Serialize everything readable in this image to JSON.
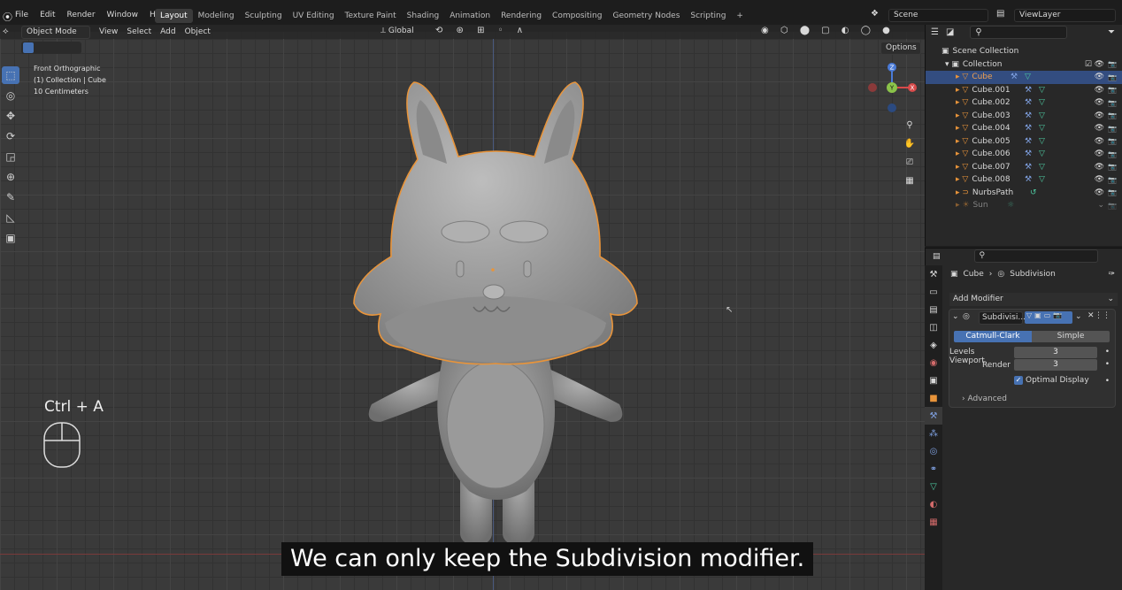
{
  "topbar": {
    "menus": [
      "File",
      "Edit",
      "Render",
      "Window",
      "Help"
    ],
    "workspaces": [
      "Layout",
      "Modeling",
      "Sculpting",
      "UV Editing",
      "Texture Paint",
      "Shading",
      "Animation",
      "Rendering",
      "Compositing",
      "Geometry Nodes",
      "Scripting"
    ],
    "add_ws": "+",
    "scene": "Scene",
    "view_layer": "ViewLayer"
  },
  "viewport": {
    "mode": "Object Mode",
    "menus": [
      "View",
      "Select",
      "Add",
      "Object"
    ],
    "orientation": "Global",
    "options": "Options",
    "overlay": [
      "Front Orthographic",
      "(1) Collection | Cube",
      "10 Centimeters"
    ],
    "gizmo": {
      "z": "Z",
      "y": "Y",
      "x": "X"
    },
    "shortcut": "Ctrl + A"
  },
  "outliner": {
    "scene_collection": "Scene Collection",
    "collection": "Collection",
    "items": [
      "Cube",
      "Cube.001",
      "Cube.002",
      "Cube.003",
      "Cube.004",
      "Cube.005",
      "Cube.006",
      "Cube.007",
      "Cube.008",
      "NurbsPath",
      "Sun"
    ]
  },
  "properties": {
    "breadcrumb_obj": "Cube",
    "breadcrumb_mod": "Subdivision",
    "add_modifier": "Add Modifier",
    "modifier_name": "Subdivisi...",
    "catmull": "Catmull-Clark",
    "simple": "Simple",
    "levels_label": "Levels Viewport",
    "levels_value": "3",
    "render_label": "Render",
    "render_value": "3",
    "optimal": "Optimal Display",
    "advanced": "Advanced"
  },
  "subtitle": "We can only keep the Subdivision modifier.",
  "colors": {
    "accent": "#4772b3",
    "select_outline": "#e8943a",
    "mesh": "#a8a8a8"
  }
}
